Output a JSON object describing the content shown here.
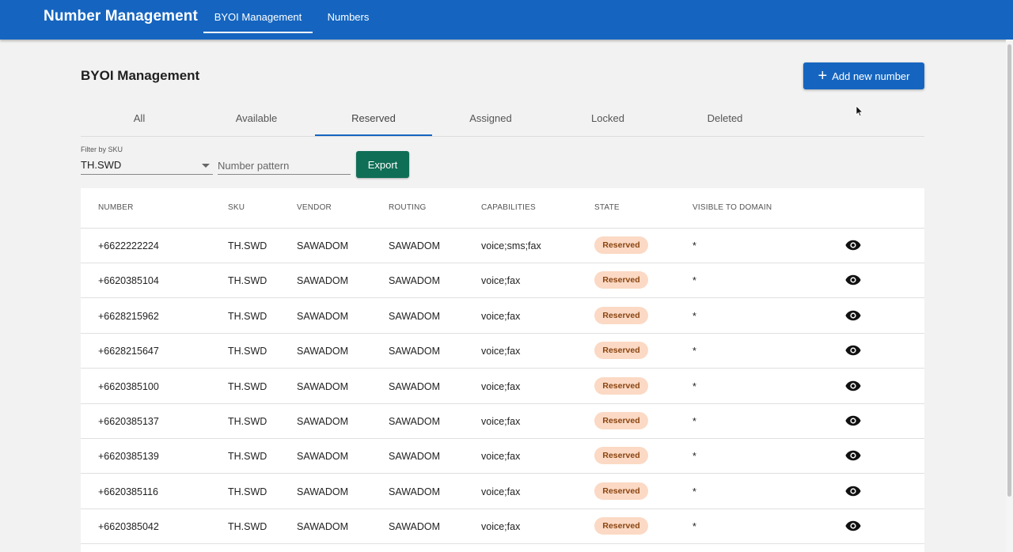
{
  "app": {
    "title": "Number Management"
  },
  "nav": {
    "tabs": [
      {
        "label": "BYOI Management",
        "active": true
      },
      {
        "label": "Numbers",
        "active": false
      }
    ]
  },
  "page": {
    "title": "BYOI Management",
    "add_button_label": "Add new number"
  },
  "tabs": [
    {
      "label": "All",
      "active": false
    },
    {
      "label": "Available",
      "active": false
    },
    {
      "label": "Reserved",
      "active": true
    },
    {
      "label": "Assigned",
      "active": false
    },
    {
      "label": "Locked",
      "active": false
    },
    {
      "label": "Deleted",
      "active": false
    }
  ],
  "filter": {
    "sku_label": "Filter by SKU",
    "sku_value": "TH.SWD",
    "pattern_placeholder": "Number pattern",
    "export_label": "Export"
  },
  "table": {
    "columns": [
      "NUMBER",
      "SKU",
      "VENDOR",
      "ROUTING",
      "CAPABILITIES",
      "STATE",
      "VISIBLE TO DOMAIN"
    ],
    "rows": [
      {
        "number": "+6622222224",
        "sku": "TH.SWD",
        "vendor": "SAWADOM",
        "routing": "SAWADOM",
        "capabilities": "voice;sms;fax",
        "state": "Reserved",
        "visible": "*"
      },
      {
        "number": "+6620385104",
        "sku": "TH.SWD",
        "vendor": "SAWADOM",
        "routing": "SAWADOM",
        "capabilities": "voice;fax",
        "state": "Reserved",
        "visible": "*"
      },
      {
        "number": "+6628215962",
        "sku": "TH.SWD",
        "vendor": "SAWADOM",
        "routing": "SAWADOM",
        "capabilities": "voice;fax",
        "state": "Reserved",
        "visible": "*"
      },
      {
        "number": "+6628215647",
        "sku": "TH.SWD",
        "vendor": "SAWADOM",
        "routing": "SAWADOM",
        "capabilities": "voice;fax",
        "state": "Reserved",
        "visible": "*"
      },
      {
        "number": "+6620385100",
        "sku": "TH.SWD",
        "vendor": "SAWADOM",
        "routing": "SAWADOM",
        "capabilities": "voice;fax",
        "state": "Reserved",
        "visible": "*"
      },
      {
        "number": "+6620385137",
        "sku": "TH.SWD",
        "vendor": "SAWADOM",
        "routing": "SAWADOM",
        "capabilities": "voice;fax",
        "state": "Reserved",
        "visible": "*"
      },
      {
        "number": "+6620385139",
        "sku": "TH.SWD",
        "vendor": "SAWADOM",
        "routing": "SAWADOM",
        "capabilities": "voice;fax",
        "state": "Reserved",
        "visible": "*"
      },
      {
        "number": "+6620385116",
        "sku": "TH.SWD",
        "vendor": "SAWADOM",
        "routing": "SAWADOM",
        "capabilities": "voice;fax",
        "state": "Reserved",
        "visible": "*"
      },
      {
        "number": "+6620385042",
        "sku": "TH.SWD",
        "vendor": "SAWADOM",
        "routing": "SAWADOM",
        "capabilities": "voice;fax",
        "state": "Reserved",
        "visible": "*"
      }
    ]
  },
  "icons": {
    "add": "plus-icon",
    "view": "eye-icon",
    "dropdown": "caret-down-icon",
    "pointer": "mouse-cursor-icon"
  },
  "colors": {
    "primary": "#1565c0",
    "export": "#0f6e56",
    "badge_bg": "#fbd9c4",
    "badge_text": "#8a4410"
  }
}
